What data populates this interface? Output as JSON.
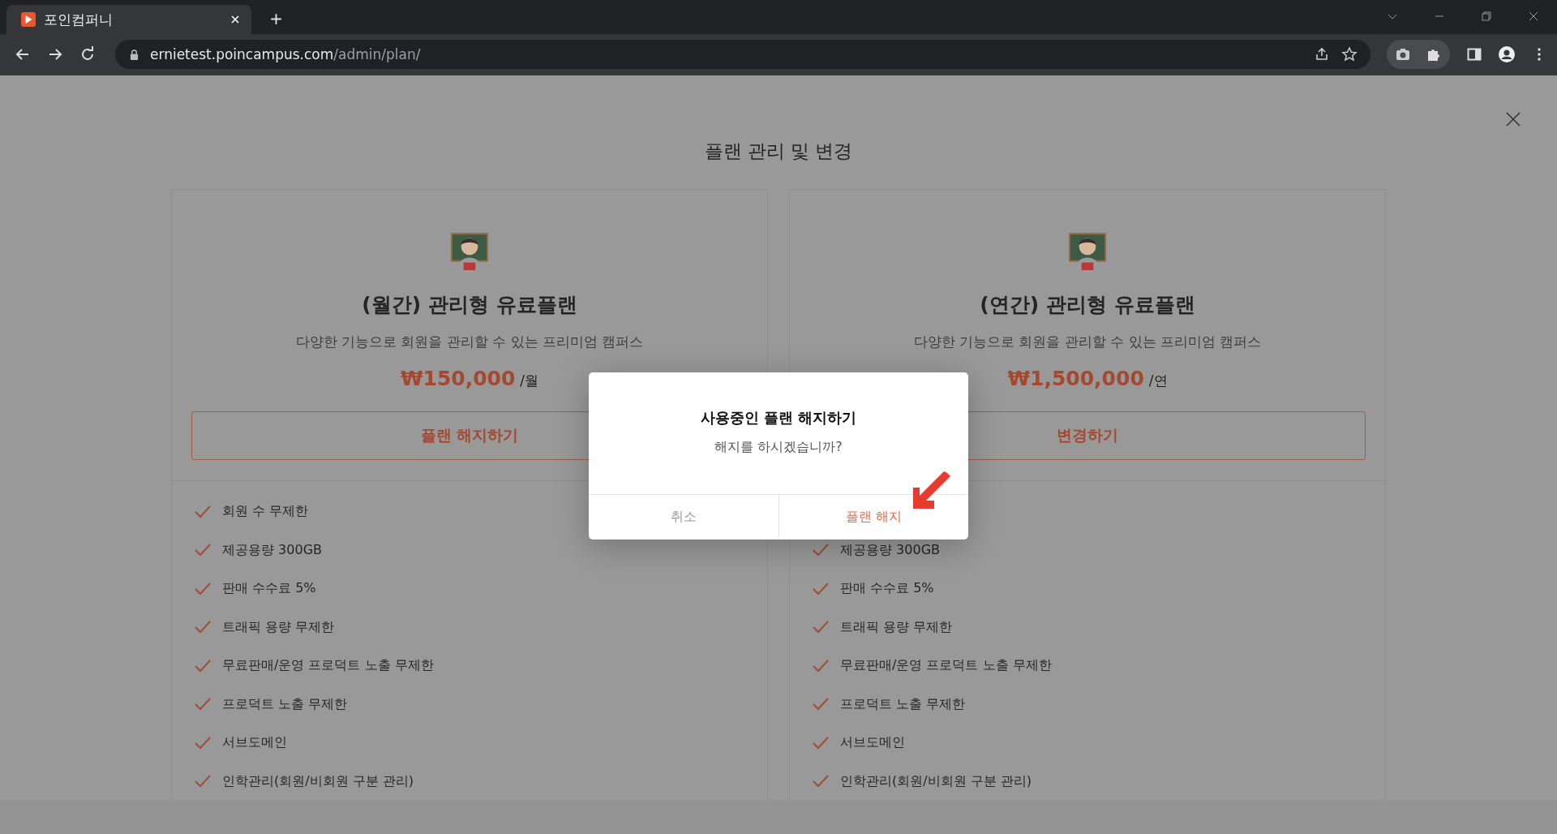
{
  "browser": {
    "tab": {
      "title": "포인컴퍼니",
      "selected": true
    },
    "url": {
      "host": "ernietest.poincampus.com",
      "path": "/admin/plan/"
    }
  },
  "page": {
    "title": "플랜 관리 및 변경",
    "cards": [
      {
        "title": "(월간) 관리형 유료플랜",
        "subtitle": "다양한 기능으로 회원을 관리할 수 있는 프리미엄 캠퍼스",
        "price": "₩150,000",
        "unit": "/월",
        "button": "플랜 해지하기",
        "features": [
          "회원 수 무제한",
          "제공용량 300GB",
          "판매 수수료 5%",
          "트래픽 용량 무제한",
          "무료판매/운영 프로덕트 노출 무제한",
          "프로덕트 노출 무제한",
          "서브도메인",
          "인학관리(회원/비회원 구분 관리)"
        ]
      },
      {
        "title": "(연간) 관리형 유료플랜",
        "subtitle": "다양한 기능으로 회원을 관리할 수 있는 프리미엄 캠퍼스",
        "price": "₩1,500,000",
        "unit": "/연",
        "button": "변경하기",
        "features": [
          "제공용량 300GB",
          "판매 수수료 5%",
          "트래픽 용량 무제한",
          "무료판매/운영 프로덕트 노출 무제한",
          "프로덕트 노출 무제한",
          "서브도메인",
          "인학관리(회원/비회원 구분 관리)"
        ]
      }
    ]
  },
  "dialog": {
    "title": "사용중인 플랜 해지하기",
    "message": "해지를 하시겠습니까?",
    "buttons": [
      {
        "label": "취소",
        "kind": "cancel"
      },
      {
        "label": "플랜 해지",
        "kind": "confirm"
      }
    ]
  }
}
